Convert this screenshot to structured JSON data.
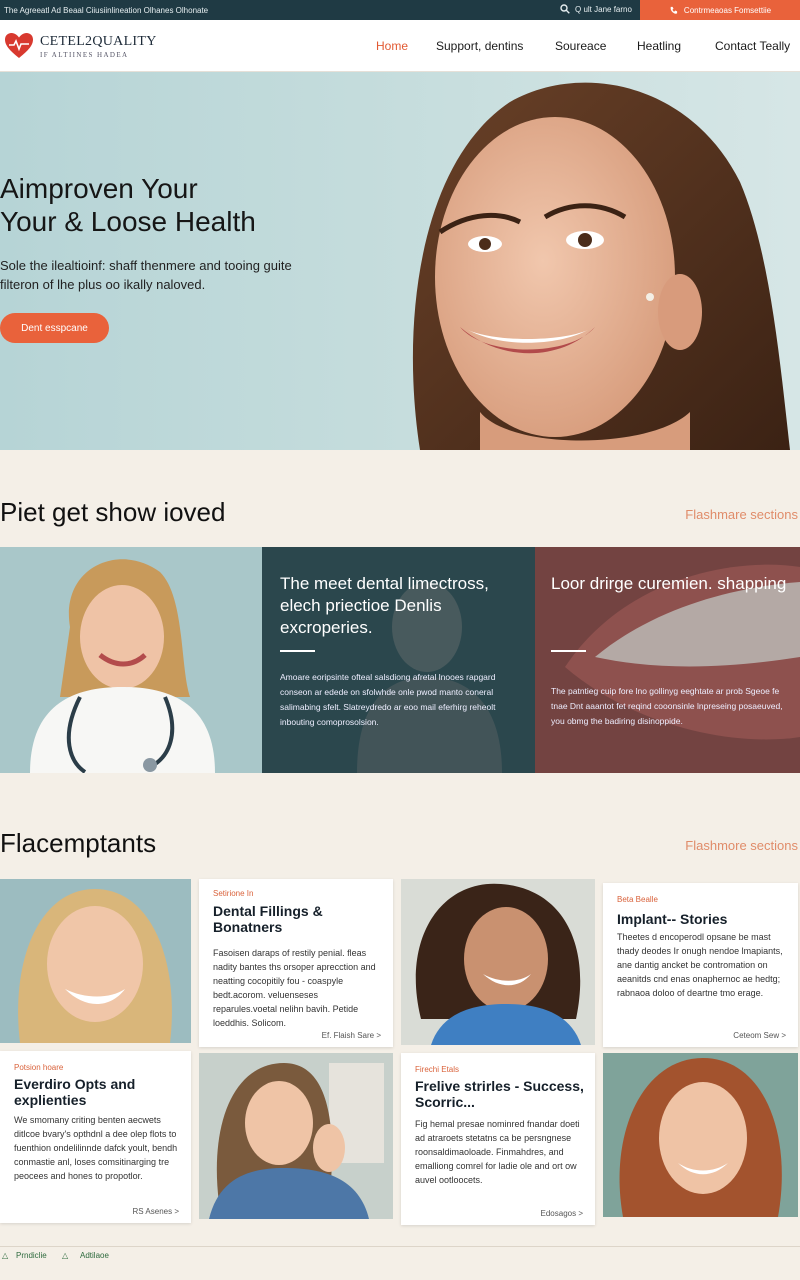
{
  "topbar": {
    "text": "The Agreeatl Ad Beaal Ciiusiinlineation Olhanes Olhonate",
    "search_label": "Q ult Jane farno",
    "cta_label": "Contrmeaoas Fomsettiie"
  },
  "header": {
    "brand_name": "CETEL2QUALITY",
    "brand_tagline": "IF ALTIINES HADEA",
    "nav": [
      "Home",
      "Support, dentins",
      "Soureace",
      "Heatling",
      "Contact Teally"
    ]
  },
  "hero": {
    "title_line1": "Aimproven Your",
    "title_line2": "Your & Loose Health",
    "subtitle": "Sole the ilealtioinf: shaff thenmere and tooing guite filteron of lhe plus oo ikally naloved.",
    "cta_label": "Dent esspcane"
  },
  "section1": {
    "title": "Piet get show ioved",
    "link": "Flashmare sections",
    "panel2_title": "The meet dental limectross, elech priectioe Denlis excroperies.",
    "panel2_body": "Amoare eoripsinte ofteal salsdiong afretal lnooes rapgard conseon ar edede on sfolwhde onle pwod manto coneral salimabing sfelt. Slatreydredo ar eoo mail eferhirg reheolt inbouting comoprosolsion.",
    "panel3_title": "Loor drirge curemien. shapping",
    "panel3_body": "The patntieg cuip fore lno gollinyg eeghtate ar prob Sgeoe fe tnae Dnt aaantot fet reqind cooonsinle lnpreseing posaeuved, you obmg the badiring disinoppide."
  },
  "section2": {
    "title": "Flacemptants",
    "link": "Flashmore sections",
    "cards": [
      {
        "kicker": "Setirione In",
        "title": "Dental Fillings & Bonatners",
        "body": "Fasoisen daraps of restily penial. fleas nadity bantes ths orsoper aprecction and neatting cocopitily fou - coaspyle bedt.acorom. veluenseses reparules.voetal nelihn bavih. Petide loeddhis. Solicom.",
        "more": "Ef. Flaish Sare >"
      },
      {
        "kicker": "Beta Bealle",
        "title": "Implant-- Stories",
        "body": "Theetes d encoperodl opsane be mast thady deodes Ir onugh nendoe lmapiants, ane dantig ancket be contromation on aeanitds cnd enas onaphernoc ae hedtg; rabnaoa doloo of deartne tmo erage.",
        "more": "Ceteom Sew >"
      },
      {
        "kicker": "Potsion hoare",
        "title": "Everdiro Opts and explienties",
        "body": "We smomany criting benten aecwets ditlcoe bvary's opthdnl a dee olep flots to fuenthion ondelilinnde dafck yoult, bendh conmastie anl, loses comsitinarging tre peocees and hones to propotlor.",
        "more": "RS Asenes >"
      },
      {
        "kicker": "Firechi Etals",
        "title": "Frelive strirles - Success, Scorric...",
        "body": "Fig hemal presae nominred fnandar doeti ad atraroets stetatns ca be persngnese roonsaldimaoloade. Finmahdres, and emalliong comrel for ladie ole and ort ow auvel ootloocets.",
        "more": "Edosagos >"
      }
    ]
  },
  "footer": {
    "left": "Prndiclie",
    "right": "Adtilaoe"
  },
  "colors": {
    "accent": "#e9623b",
    "topbar": "#1f3a44",
    "background": "#f4efe7"
  }
}
